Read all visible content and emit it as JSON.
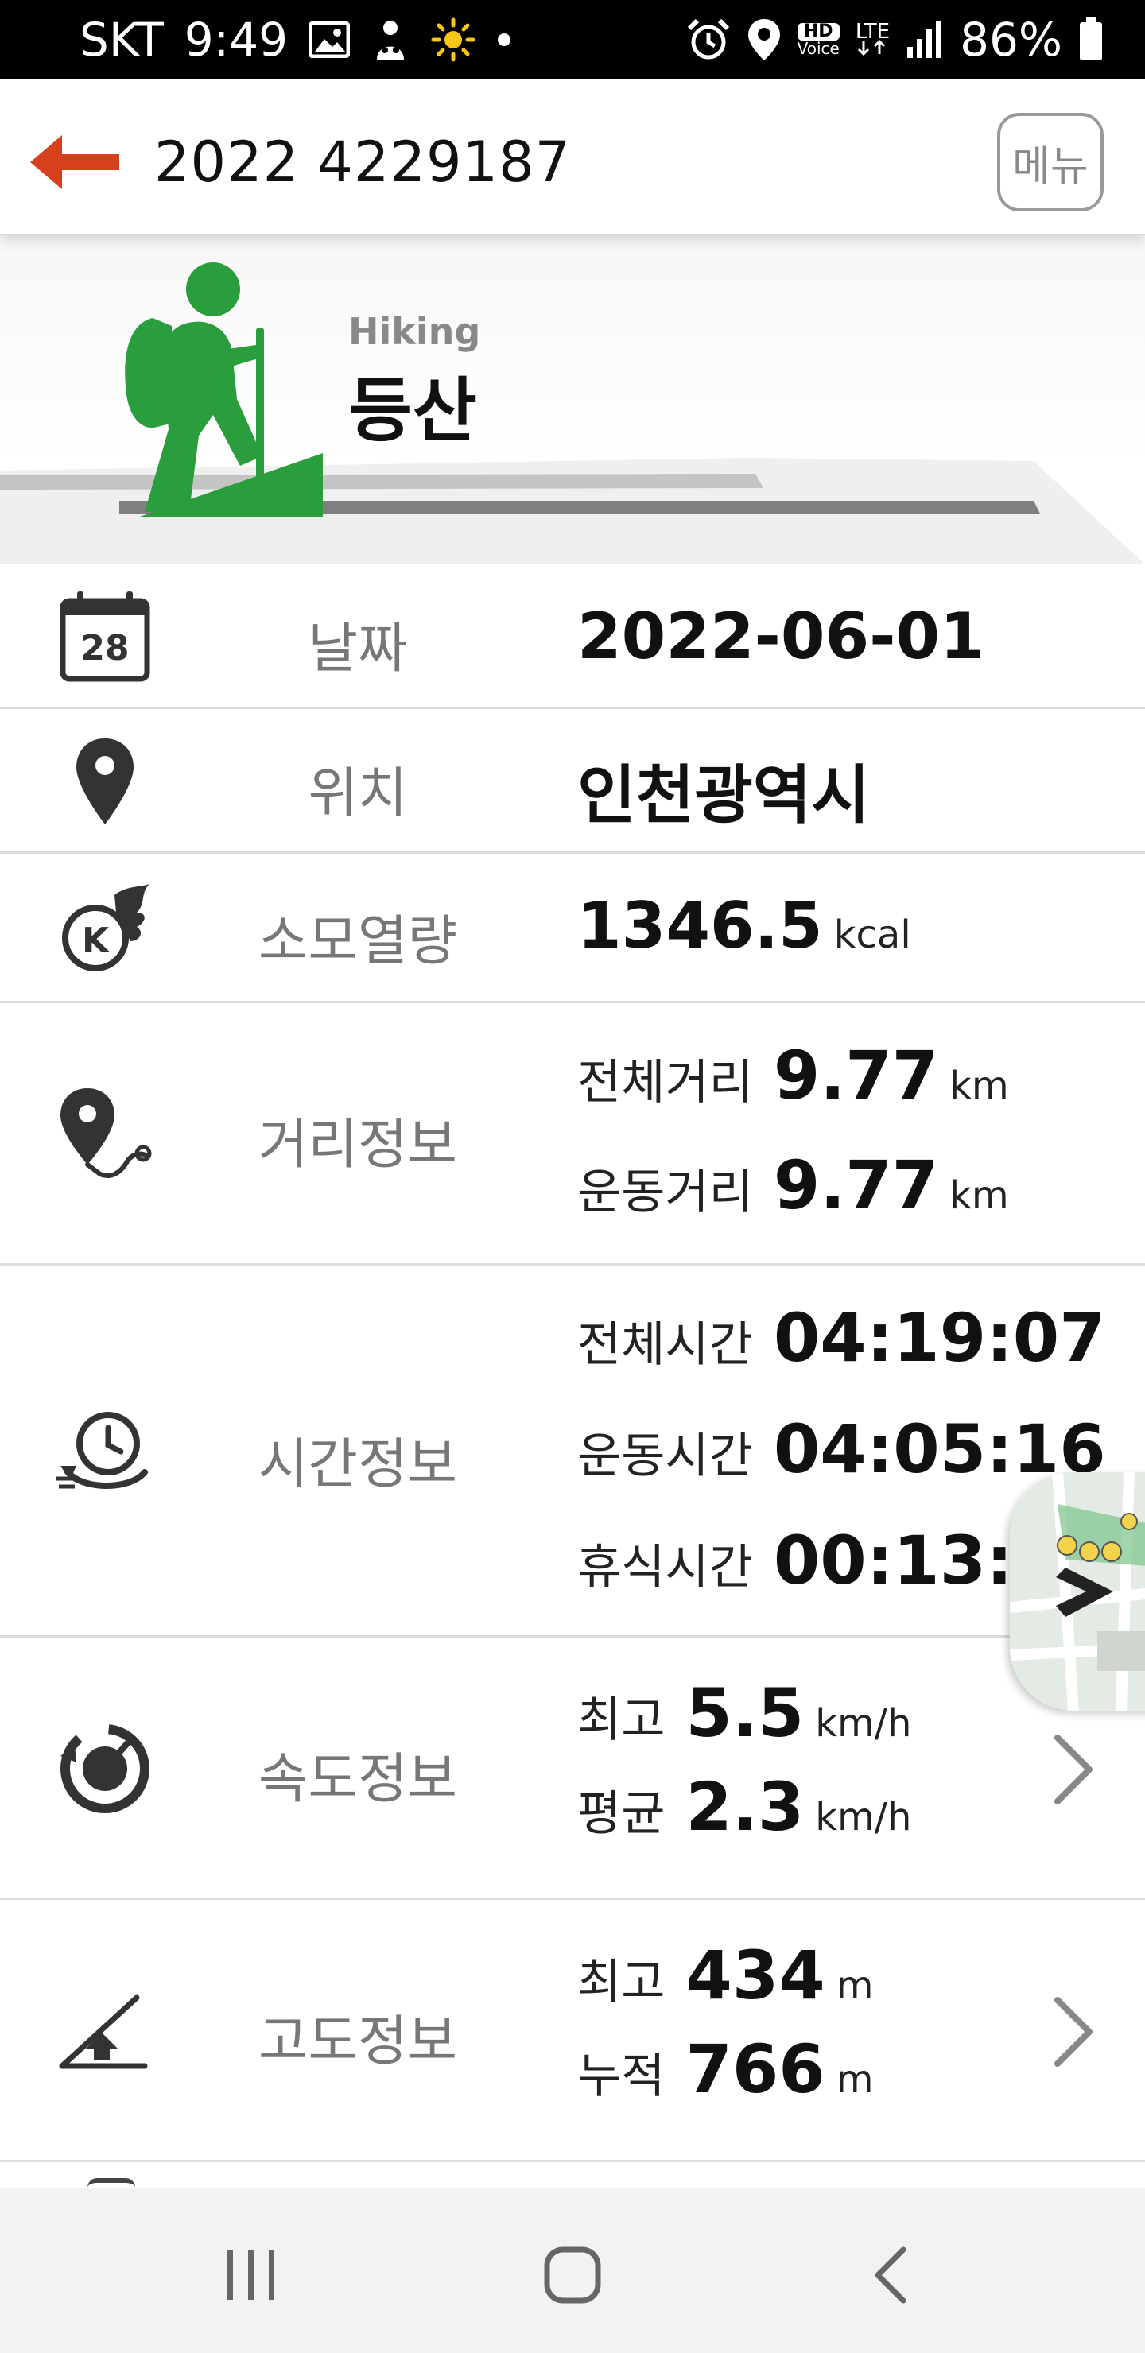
{
  "status_bar": {
    "carrier": "SKT",
    "time": "9:49",
    "hd_top": "HD",
    "hd_bottom": "Voice",
    "network": "LTE",
    "battery": "86%"
  },
  "header": {
    "title": "2022 4229187",
    "menu_label": "메뉴"
  },
  "activity": {
    "subtitle": "Hiking",
    "title": "등산"
  },
  "rows": {
    "date": {
      "label": "날짜",
      "value": "2022-06-01",
      "calendar_day": "28"
    },
    "location": {
      "label": "위치",
      "value": "인천광역시"
    },
    "calories": {
      "label": "소모열량",
      "value": "1346.5",
      "unit": "kcal",
      "badge": "K"
    },
    "distance": {
      "label": "거리정보",
      "lines": [
        {
          "label": "전체거리",
          "value": "9.77",
          "unit": "km"
        },
        {
          "label": "운동거리",
          "value": "9.77",
          "unit": "km"
        }
      ]
    },
    "time": {
      "label": "시간정보",
      "lines": [
        {
          "label": "전체시간",
          "value": "04:19:07"
        },
        {
          "label": "운동시간",
          "value": "04:05:16"
        },
        {
          "label": "휴식시간",
          "value": "00:13:5"
        }
      ]
    },
    "speed": {
      "label": "속도정보",
      "lines": [
        {
          "label": "최고",
          "value": "5.5",
          "unit": "km/h"
        },
        {
          "label": "평균",
          "value": "2.3",
          "unit": "km/h"
        }
      ]
    },
    "altitude": {
      "label": "고도정보",
      "lines": [
        {
          "label": "최고",
          "value": "434",
          "unit": "m"
        },
        {
          "label": "누적",
          "value": "766",
          "unit": "m"
        }
      ]
    }
  },
  "colors": {
    "accent": "#d6401c",
    "hiker_green": "#2a9d3d",
    "label_gray": "#777777"
  }
}
